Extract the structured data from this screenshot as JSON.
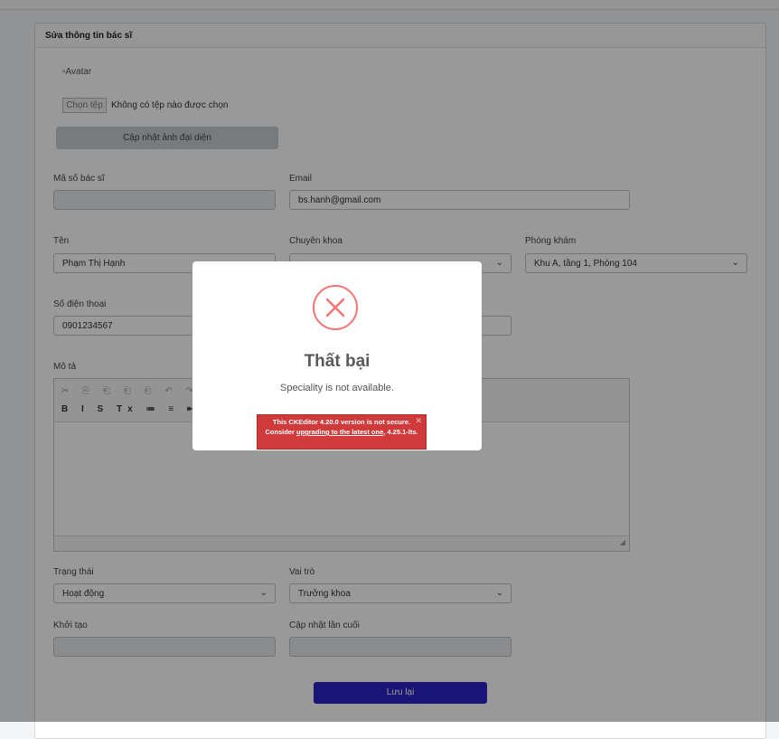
{
  "card": {
    "title": "Sửa thông tin bác sĩ"
  },
  "avatar": {
    "alt": "Avatar",
    "choose_file": "Chọn tệp",
    "no_file": "Không có tệp nào được chọn",
    "update_button": "Cập nhật ảnh đại diện"
  },
  "fields": {
    "doctor_id": {
      "label": "Mã số bác sĩ",
      "value": ""
    },
    "email": {
      "label": "Email",
      "value": "bs.hanh@gmail.com"
    },
    "name": {
      "label": "Tên",
      "value": "Phạm Thị Hạnh"
    },
    "speciality": {
      "label": "Chuyên khoa",
      "value": ""
    },
    "clinic": {
      "label": "Phòng khám",
      "value": "Khu A, tầng 1, Phòng 104"
    },
    "phone": {
      "label": "Số điện thoại",
      "value": "0901234567"
    },
    "description": {
      "label": "Mô tả"
    },
    "status": {
      "label": "Trạng thái",
      "value": "Hoạt động"
    },
    "role": {
      "label": "Vai trò",
      "value": "Trưởng khoa"
    },
    "created": {
      "label": "Khởi tạo",
      "value": ""
    },
    "updated": {
      "label": "Cập nhật lần cuối",
      "value": ""
    }
  },
  "editor": {
    "row1_icons": "✂ ⎘ ⎗ ⎗ ⎗ ↶ ↷ ᴬᴮᶜ",
    "row2_icons": "B I S Tx ≔ ≡ ⇤ ⇥"
  },
  "save_button": "Lưu lại",
  "modal": {
    "icon": "error-x-icon",
    "title": "Thất bại",
    "message": "Speciality is not available."
  },
  "ckeditor_warning": {
    "line1": "This CKEditor 4.20.0 version is not secure.",
    "consider": "Consider",
    "link": "upgrading to the latest one",
    "tail": ", 4.25.1-lts.",
    "close": "✕"
  },
  "colors": {
    "primary": "#2e22c7",
    "error": "#f27474",
    "warning_bg": "#d13a3a"
  }
}
